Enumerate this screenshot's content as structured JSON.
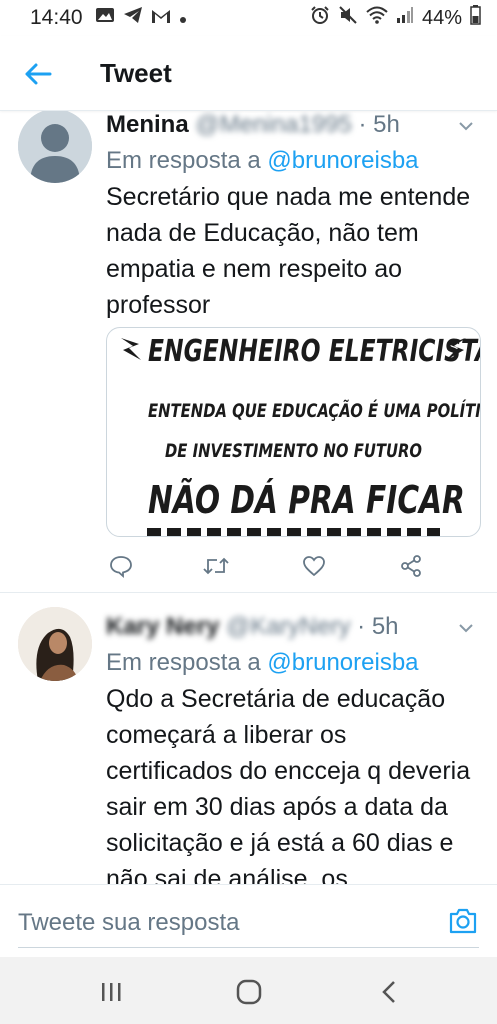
{
  "status_bar": {
    "time": "14:40",
    "battery": "44%",
    "icons_left": [
      "gallery-icon",
      "telegram-icon",
      "gmail-icon",
      "dot-icon"
    ],
    "icons_right": [
      "alarm-icon",
      "mute-icon",
      "wifi-icon",
      "signal-icon",
      "battery-icon"
    ]
  },
  "header": {
    "title": "Tweet"
  },
  "tweets": [
    {
      "name": "Menina",
      "handle": "@Menina1995",
      "time": "5h",
      "reply_prefix": "Em resposta a",
      "reply_to": "@brunoreisba",
      "text": "Secretário que nada me entende nada de Educação, não tem empatia e nem respeito ao professor",
      "media": {
        "line1": "ENGENHEIRO ELETRICISTA",
        "line2": "ENTENDA QUE EDUCAÇÃO É UMA POLÍTICA",
        "line3": "DE INVESTIMENTO NO FUTURO",
        "line4": "NÃO DÁ PRA FICAR"
      }
    },
    {
      "name": "Kary Nery",
      "handle": "@KaryNery",
      "time": "5h",
      "reply_prefix": "Em resposta a",
      "reply_to": "@brunoreisba",
      "text": "Qdo a Secretária de educação começará a liberar os certificados do encceja q deveria sair em 30 dias após a data da solicitação e já está a 60 dias e não sai de análise, os"
    }
  ],
  "composer": {
    "placeholder": "Tweete sua resposta"
  },
  "colors": {
    "accent": "#1da1f2",
    "secondary_text": "#657786",
    "divider": "#e6ecf0"
  }
}
